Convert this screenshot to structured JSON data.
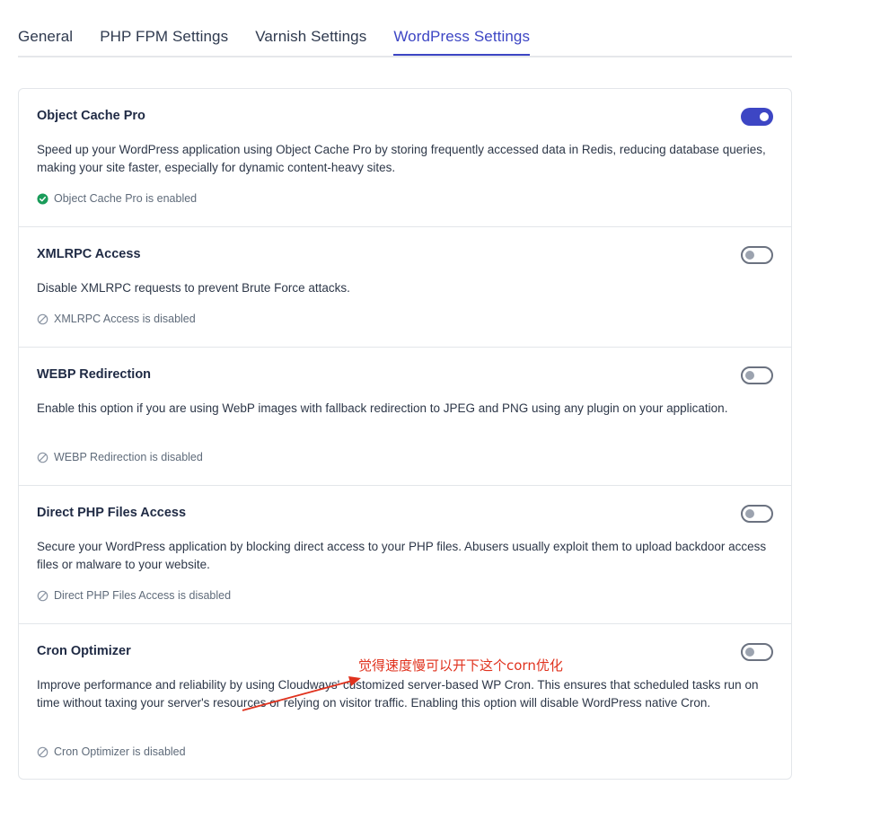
{
  "tabs": [
    {
      "label": "General",
      "active": false
    },
    {
      "label": "PHP FPM Settings",
      "active": false
    },
    {
      "label": "Varnish Settings",
      "active": false
    },
    {
      "label": "WordPress Settings",
      "active": true
    }
  ],
  "settings": [
    {
      "title": "Object Cache Pro",
      "description": "Speed up your WordPress application using Object Cache Pro by storing frequently accessed data in Redis, reducing database queries, making your site faster, especially for dynamic content-heavy sites.",
      "status": "Object Cache Pro is enabled",
      "enabled": true
    },
    {
      "title": "XMLRPC Access",
      "description": "Disable XMLRPC requests to prevent Brute Force attacks.",
      "status": "XMLRPC Access is disabled",
      "enabled": false
    },
    {
      "title": "WEBP Redirection",
      "description": "Enable this option if you are using WebP images with fallback redirection to JPEG and PNG using any plugin on your application.",
      "status": "WEBP Redirection is disabled",
      "enabled": false
    },
    {
      "title": "Direct PHP Files Access",
      "description": "Secure your WordPress application by blocking direct access to your PHP files. Abusers usually exploit them to upload backdoor access files or malware to your website.",
      "status": "Direct PHP Files Access is disabled",
      "enabled": false
    },
    {
      "title": "Cron Optimizer",
      "description": "Improve performance and reliability by using Cloudways' customized server-based WP Cron. This ensures that scheduled tasks run on time without taxing your server's resources or relying on visitor traffic. Enabling this option will disable WordPress native Cron.",
      "status": "Cron Optimizer is disabled",
      "enabled": false
    }
  ],
  "annotation": {
    "text": "觉得速度慢可以开下这个corn优化",
    "color": "#e0321e"
  },
  "colors": {
    "accent": "#3d46c4",
    "enabled_status": "#1a9c5a",
    "disabled_status": "#8a94a3"
  },
  "icons": {
    "enabled": "check-circle-icon",
    "disabled": "disabled-circle-icon"
  }
}
